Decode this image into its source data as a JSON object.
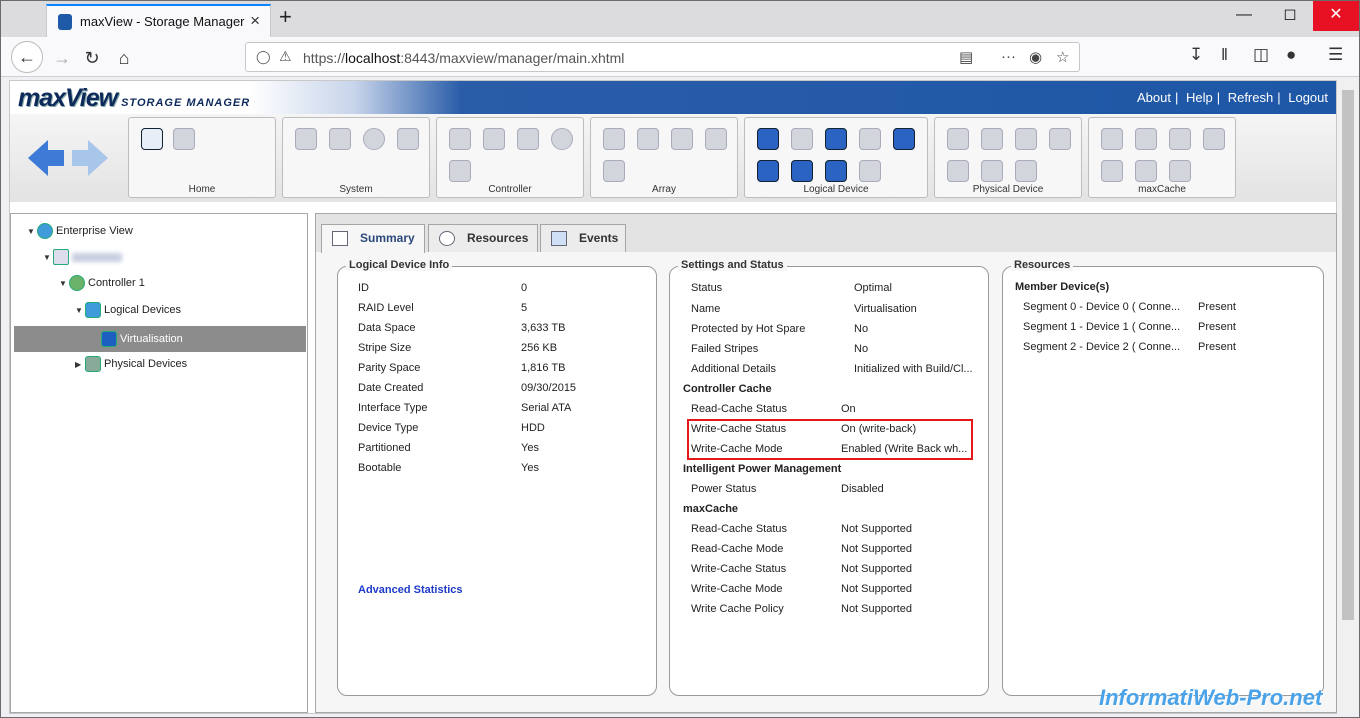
{
  "browser": {
    "tab_title": "maxView - Storage Manager",
    "url_prefix": "https://",
    "url_host": "localhost",
    "url_rest": ":8443/maxview/manager/main.xhtml",
    "new_tab": "+",
    "close_tab": "×"
  },
  "header": {
    "logo_main": "maxView",
    "logo_sub": "STORAGE MANAGER",
    "links": [
      "About",
      "Help",
      "Refresh",
      "Logout"
    ]
  },
  "toolbar": {
    "groups": [
      "Home",
      "System",
      "Controller",
      "Array",
      "Logical Device",
      "Physical Device",
      "maxCache"
    ]
  },
  "tree": {
    "items": [
      "Enterprise View",
      "",
      "Controller 1",
      "Logical Devices",
      "Virtualisation",
      "Physical Devices"
    ]
  },
  "tabs": [
    "Summary",
    "Resources",
    "Events"
  ],
  "logical_device_info": {
    "title": "Logical Device Info",
    "rows": [
      {
        "label": "ID",
        "value": "0"
      },
      {
        "label": "RAID Level",
        "value": "5"
      },
      {
        "label": "Data Space",
        "value": "3,633 TB"
      },
      {
        "label": "Stripe Size",
        "value": "256 KB"
      },
      {
        "label": "Parity Space",
        "value": "1,816 TB"
      },
      {
        "label": "Date Created",
        "value": "09/30/2015"
      },
      {
        "label": "Interface Type",
        "value": "Serial ATA"
      },
      {
        "label": "Device Type",
        "value": "HDD"
      },
      {
        "label": "Partitioned",
        "value": "Yes"
      },
      {
        "label": "Bootable",
        "value": "Yes"
      }
    ],
    "advanced_link": "Advanced Statistics"
  },
  "settings_status": {
    "title": "Settings and Status",
    "rows": [
      {
        "label": "Status",
        "value": "Optimal"
      },
      {
        "label": "Name",
        "value": "Virtualisation"
      },
      {
        "label": "Protected by Hot Spare",
        "value": "No"
      },
      {
        "label": "Failed Stripes",
        "value": "No"
      },
      {
        "label": "Additional Details",
        "value": "Initialized with Build/Cl..."
      }
    ],
    "controller_cache_title": "Controller Cache",
    "controller_cache": [
      {
        "label": "Read-Cache Status",
        "value": "On"
      },
      {
        "label": "Write-Cache Status",
        "value": "On (write-back)"
      },
      {
        "label": "Write-Cache Mode",
        "value": "Enabled (Write Back wh..."
      }
    ],
    "ipm_title": "Intelligent Power Management",
    "ipm": [
      {
        "label": "Power Status",
        "value": "Disabled"
      }
    ],
    "maxcache_title": "maxCache",
    "maxcache": [
      {
        "label": "Read-Cache Status",
        "value": "Not Supported"
      },
      {
        "label": "Read-Cache Mode",
        "value": "Not Supported"
      },
      {
        "label": "Write-Cache Status",
        "value": "Not Supported"
      },
      {
        "label": "Write-Cache Mode",
        "value": "Not Supported"
      },
      {
        "label": "Write Cache Policy",
        "value": "Not Supported"
      }
    ]
  },
  "resources": {
    "title": "Resources",
    "member_title": "Member Device(s)",
    "members": [
      {
        "name": "Segment 0 - Device 0 ( Conne...",
        "state": "Present"
      },
      {
        "name": "Segment 1 - Device 1 ( Conne...",
        "state": "Present"
      },
      {
        "name": "Segment 2 - Device 2 ( Conne...",
        "state": "Present"
      }
    ]
  },
  "watermark": "InformatiWeb-Pro.net"
}
